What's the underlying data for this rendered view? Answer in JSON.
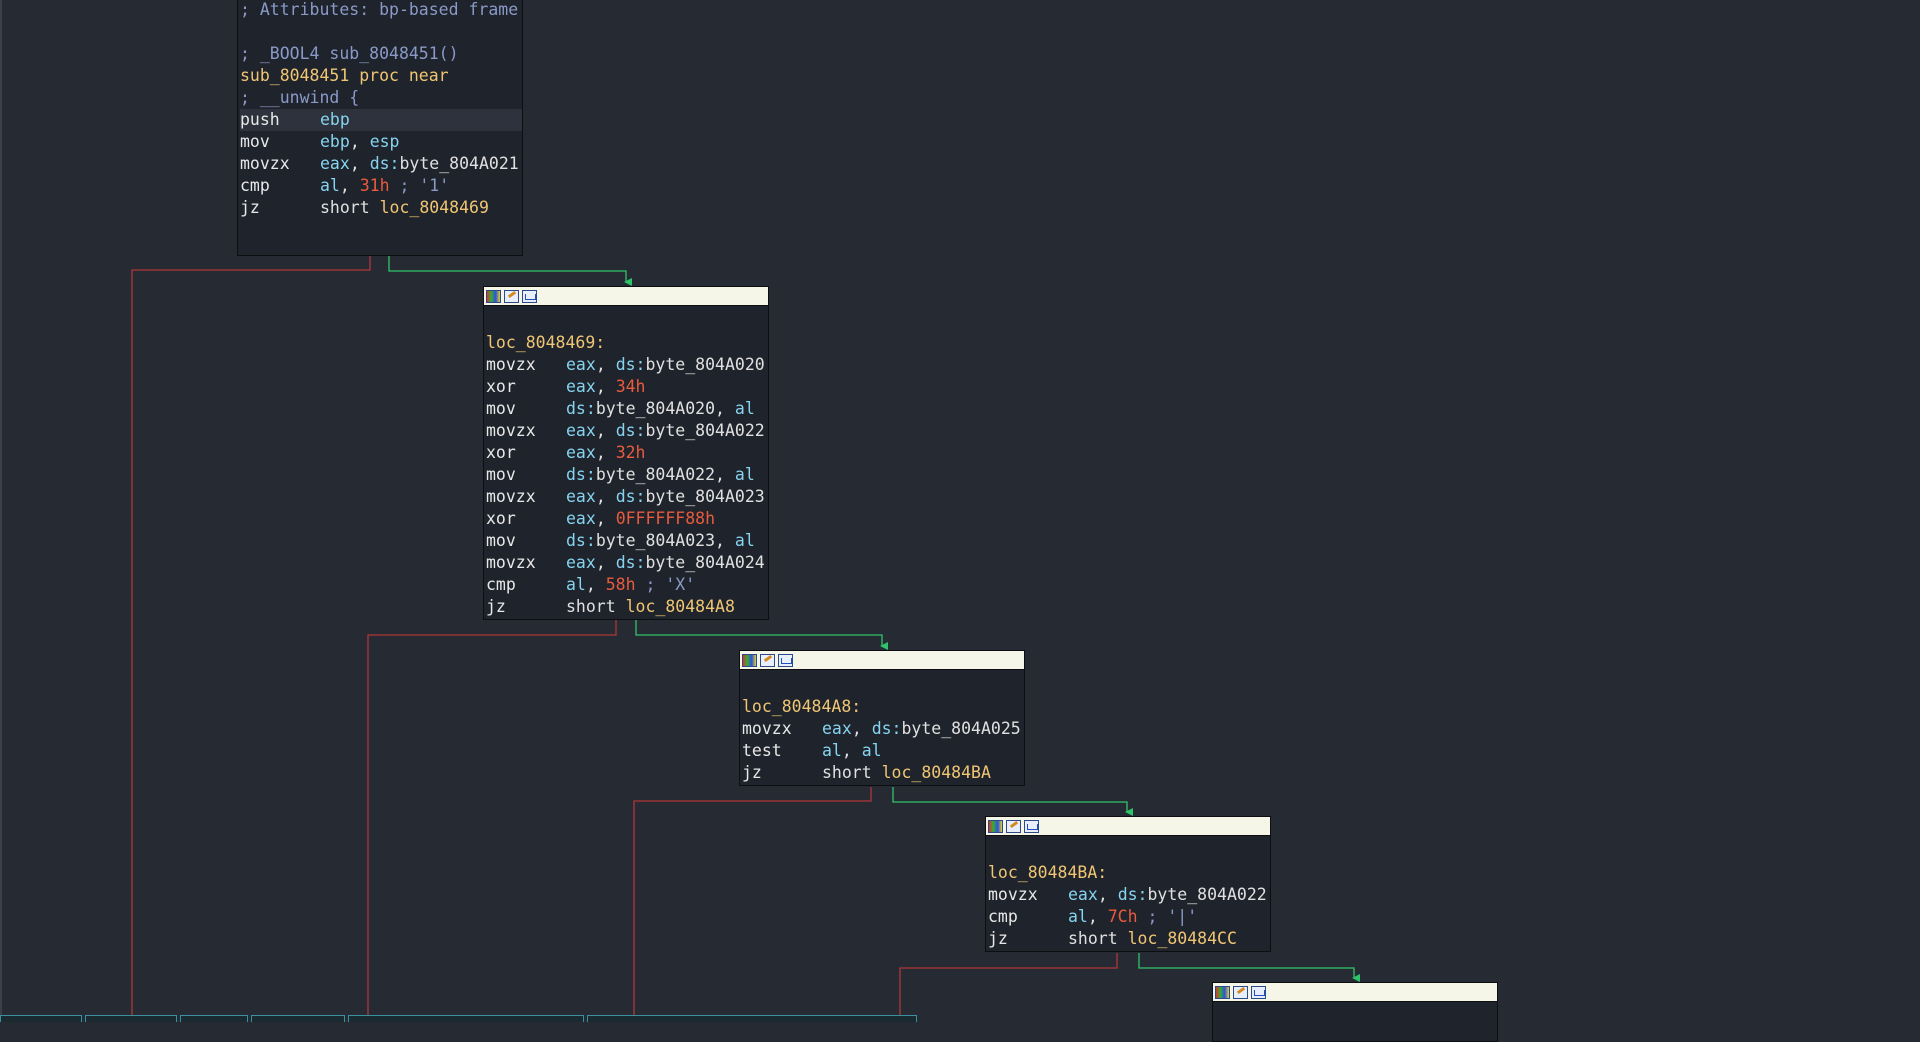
{
  "nodes": [
    {
      "id": "node-sub-8048451",
      "header": false,
      "lines": [
        {
          "type": "comment",
          "text": "; Attributes: bp-based frame"
        },
        {
          "type": "blank"
        },
        {
          "type": "comment",
          "text": "; _BOOL4 sub_8048451()"
        },
        {
          "type": "label",
          "text": "sub_8048451 proc near"
        },
        {
          "type": "comment",
          "text": "; __unwind {"
        },
        {
          "type": "instr",
          "hl": true,
          "mn": "push",
          "ops": [
            {
              "c": "reg",
              "t": "ebp"
            }
          ]
        },
        {
          "type": "instr",
          "mn": "mov",
          "ops": [
            {
              "c": "reg",
              "t": "ebp"
            },
            {
              "c": "plain",
              "t": ", "
            },
            {
              "c": "reg",
              "t": "esp"
            }
          ]
        },
        {
          "type": "instr",
          "mn": "movzx",
          "ops": [
            {
              "c": "reg",
              "t": "eax"
            },
            {
              "c": "plain",
              "t": ", "
            },
            {
              "c": "pre",
              "t": "ds:"
            },
            {
              "c": "plain",
              "t": "byte_804A021"
            }
          ]
        },
        {
          "type": "instr",
          "mn": "cmp",
          "ops": [
            {
              "c": "reg",
              "t": "al"
            },
            {
              "c": "plain",
              "t": ", "
            },
            {
              "c": "num",
              "t": "31h"
            },
            {
              "c": "cmt",
              "t": " ; '1'"
            }
          ]
        },
        {
          "type": "instr",
          "mn": "jz",
          "ops": [
            {
              "c": "plain",
              "t": "short "
            },
            {
              "c": "ref",
              "t": "loc_8048469"
            }
          ]
        }
      ]
    },
    {
      "id": "node-loc-8048469",
      "header": true,
      "lines": [
        {
          "type": "blank"
        },
        {
          "type": "label",
          "text": "loc_8048469:"
        },
        {
          "type": "instr",
          "mn": "movzx",
          "ops": [
            {
              "c": "reg",
              "t": "eax"
            },
            {
              "c": "plain",
              "t": ", "
            },
            {
              "c": "pre",
              "t": "ds:"
            },
            {
              "c": "plain",
              "t": "byte_804A020"
            }
          ]
        },
        {
          "type": "instr",
          "mn": "xor",
          "ops": [
            {
              "c": "reg",
              "t": "eax"
            },
            {
              "c": "plain",
              "t": ", "
            },
            {
              "c": "num",
              "t": "34h"
            }
          ]
        },
        {
          "type": "instr",
          "mn": "mov",
          "ops": [
            {
              "c": "pre",
              "t": "ds:"
            },
            {
              "c": "plain",
              "t": "byte_804A020, "
            },
            {
              "c": "reg",
              "t": "al"
            }
          ]
        },
        {
          "type": "instr",
          "mn": "movzx",
          "ops": [
            {
              "c": "reg",
              "t": "eax"
            },
            {
              "c": "plain",
              "t": ", "
            },
            {
              "c": "pre",
              "t": "ds:"
            },
            {
              "c": "plain",
              "t": "byte_804A022"
            }
          ]
        },
        {
          "type": "instr",
          "mn": "xor",
          "ops": [
            {
              "c": "reg",
              "t": "eax"
            },
            {
              "c": "plain",
              "t": ", "
            },
            {
              "c": "num",
              "t": "32h"
            }
          ]
        },
        {
          "type": "instr",
          "mn": "mov",
          "ops": [
            {
              "c": "pre",
              "t": "ds:"
            },
            {
              "c": "plain",
              "t": "byte_804A022, "
            },
            {
              "c": "reg",
              "t": "al"
            }
          ]
        },
        {
          "type": "instr",
          "mn": "movzx",
          "ops": [
            {
              "c": "reg",
              "t": "eax"
            },
            {
              "c": "plain",
              "t": ", "
            },
            {
              "c": "pre",
              "t": "ds:"
            },
            {
              "c": "plain",
              "t": "byte_804A023"
            }
          ]
        },
        {
          "type": "instr",
          "mn": "xor",
          "ops": [
            {
              "c": "reg",
              "t": "eax"
            },
            {
              "c": "plain",
              "t": ", "
            },
            {
              "c": "num",
              "t": "0FFFFFF88h"
            }
          ]
        },
        {
          "type": "instr",
          "mn": "mov",
          "ops": [
            {
              "c": "pre",
              "t": "ds:"
            },
            {
              "c": "plain",
              "t": "byte_804A023, "
            },
            {
              "c": "reg",
              "t": "al"
            }
          ]
        },
        {
          "type": "instr",
          "mn": "movzx",
          "ops": [
            {
              "c": "reg",
              "t": "eax"
            },
            {
              "c": "plain",
              "t": ", "
            },
            {
              "c": "pre",
              "t": "ds:"
            },
            {
              "c": "plain",
              "t": "byte_804A024"
            }
          ]
        },
        {
          "type": "instr",
          "mn": "cmp",
          "ops": [
            {
              "c": "reg",
              "t": "al"
            },
            {
              "c": "plain",
              "t": ", "
            },
            {
              "c": "num",
              "t": "58h"
            },
            {
              "c": "cmt",
              "t": " ; 'X'"
            }
          ]
        },
        {
          "type": "instr",
          "mn": "jz",
          "ops": [
            {
              "c": "plain",
              "t": "short "
            },
            {
              "c": "ref",
              "t": "loc_80484A8"
            }
          ]
        }
      ]
    },
    {
      "id": "node-loc-80484a8",
      "header": true,
      "lines": [
        {
          "type": "blank"
        },
        {
          "type": "label",
          "text": "loc_80484A8:"
        },
        {
          "type": "instr",
          "mn": "movzx",
          "ops": [
            {
              "c": "reg",
              "t": "eax"
            },
            {
              "c": "plain",
              "t": ", "
            },
            {
              "c": "pre",
              "t": "ds:"
            },
            {
              "c": "plain",
              "t": "byte_804A025"
            }
          ]
        },
        {
          "type": "instr",
          "mn": "test",
          "ops": [
            {
              "c": "reg",
              "t": "al"
            },
            {
              "c": "plain",
              "t": ", "
            },
            {
              "c": "reg",
              "t": "al"
            }
          ]
        },
        {
          "type": "instr",
          "mn": "jz",
          "ops": [
            {
              "c": "plain",
              "t": "short "
            },
            {
              "c": "ref",
              "t": "loc_80484BA"
            }
          ]
        }
      ]
    },
    {
      "id": "node-loc-80484ba",
      "header": true,
      "lines": [
        {
          "type": "blank"
        },
        {
          "type": "label",
          "text": "loc_80484BA:"
        },
        {
          "type": "instr",
          "mn": "movzx",
          "ops": [
            {
              "c": "reg",
              "t": "eax"
            },
            {
              "c": "plain",
              "t": ", "
            },
            {
              "c": "pre",
              "t": "ds:"
            },
            {
              "c": "plain",
              "t": "byte_804A022"
            }
          ]
        },
        {
          "type": "instr",
          "mn": "cmp",
          "ops": [
            {
              "c": "reg",
              "t": "al"
            },
            {
              "c": "plain",
              "t": ", "
            },
            {
              "c": "num",
              "t": "7Ch"
            },
            {
              "c": "cmt",
              "t": " ; '|'"
            }
          ]
        },
        {
          "type": "instr",
          "mn": "jz",
          "ops": [
            {
              "c": "plain",
              "t": "short "
            },
            {
              "c": "ref",
              "t": "loc_80484CC"
            }
          ]
        }
      ]
    },
    {
      "id": "node-loc-80484cc",
      "header": true,
      "lines": []
    }
  ],
  "header_icons": [
    "color-palette-icon",
    "pencil-edit-icon",
    "graph-view-icon"
  ],
  "colors": {
    "background": "#262a33",
    "node_bg": "#1f232b",
    "false_edge": "#b0363a",
    "true_edge": "#2fc46a",
    "register": "#86d4f0",
    "number": "#e85b3e",
    "comment": "#8a9ac8",
    "label": "#f0c674"
  }
}
